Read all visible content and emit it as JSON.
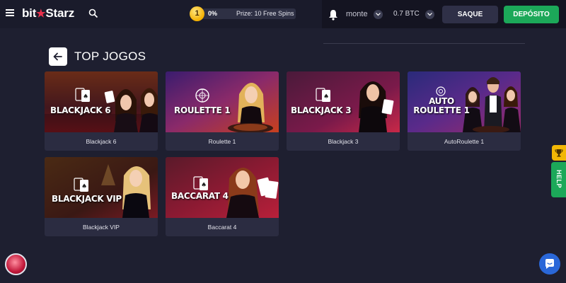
{
  "header": {
    "logo_left": "bit",
    "logo_star": "★",
    "logo_right": "Starz",
    "bonus": {
      "level": "1",
      "percent": "0%",
      "prize": "Prize: 10 Free Spins"
    },
    "username": "monte",
    "balance": "0.7 BTC",
    "withdraw_label": "SAQUE",
    "deposit_label": "DEPÓSITO"
  },
  "page": {
    "title": "TOP JOGOS"
  },
  "games": [
    {
      "thumb_title": "BLACKJACK 6",
      "label": "Blackjack 6"
    },
    {
      "thumb_title": "ROULETTE 1",
      "label": "Roulette 1"
    },
    {
      "thumb_title": "BLACKJACK 3",
      "label": "Blackjack 3"
    },
    {
      "thumb_title": "AUTO ROULETTE 1",
      "label": "AutoRoulette 1"
    },
    {
      "thumb_title": "BLACKJACK VIP",
      "label": "Blackjack VIP"
    },
    {
      "thumb_title": "BACCARAT 4",
      "label": "Baccarat 4"
    }
  ],
  "widgets": {
    "help_label": "HELP"
  },
  "colors": {
    "background": "#1e1f30",
    "deposit_green": "#1ca859",
    "brand_red": "#e8304c",
    "card_bg": "#2b2c41"
  }
}
